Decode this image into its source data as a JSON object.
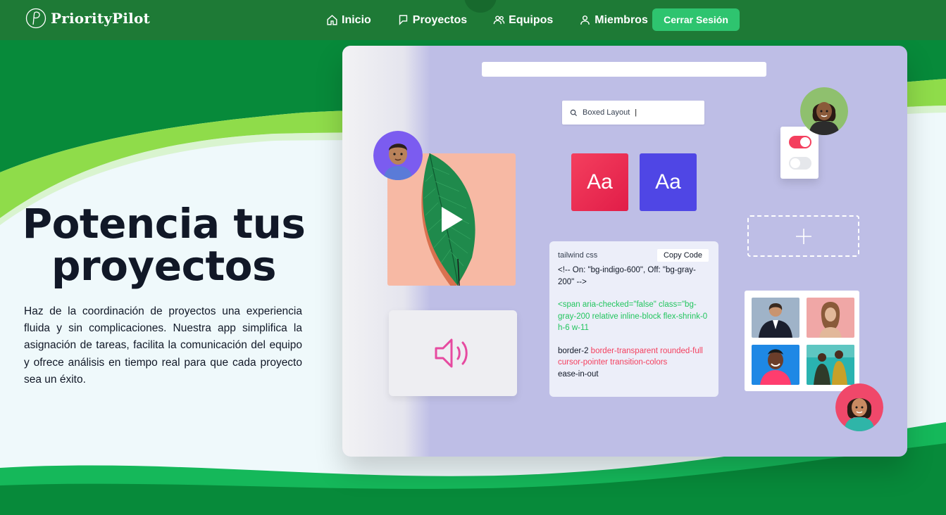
{
  "brand": {
    "name": "PriorityPilot",
    "logo_letter": "P"
  },
  "nav": {
    "items": [
      {
        "label": "Inicio",
        "icon": "home-icon"
      },
      {
        "label": "Proyectos",
        "icon": "bookmark-icon"
      },
      {
        "label": "Equipos",
        "icon": "users-icon"
      },
      {
        "label": "Miembros",
        "icon": "user-icon"
      }
    ],
    "logout_label": "Cerrar Sesión"
  },
  "hero": {
    "title_line1": "Potencia tus",
    "title_line2": "proyectos",
    "description": "Haz de la coordinación de proyectos una experiencia fluida y sin complicaciones. Nuestra app simplifica la asignación de tareas, facilita la comunicación del equipo y ofrece análisis en tiempo real para que cada proyecto sea un éxito."
  },
  "mockup": {
    "search_value": "Boxed Layout",
    "font_card_1": "Aa",
    "font_card_2": "Aa",
    "code": {
      "lang": "tailwind css",
      "copy_label": "Copy Code",
      "comment": "<!-- On: \"bg-indigo-600\", Off: \"bg-gray-200\" -->",
      "span_line": "<span aria-checked=\"false\" class=\"bg-gray-200 relative inline-block flex-shrink-0 h-6 w-11",
      "border_prefix": "border-2",
      "border_classes": "border-transparent rounded-full cursor-pointer transition-colors",
      "ease": "ease-in-out"
    },
    "toggles": [
      {
        "state": "on"
      },
      {
        "state": "off"
      }
    ]
  },
  "colors": {
    "nav_bg": "#1e7a36",
    "accent_green": "#2ec46f",
    "panel_bg": "#bebee6",
    "rose": "#f43f5e",
    "indigo": "#4f46e5"
  }
}
